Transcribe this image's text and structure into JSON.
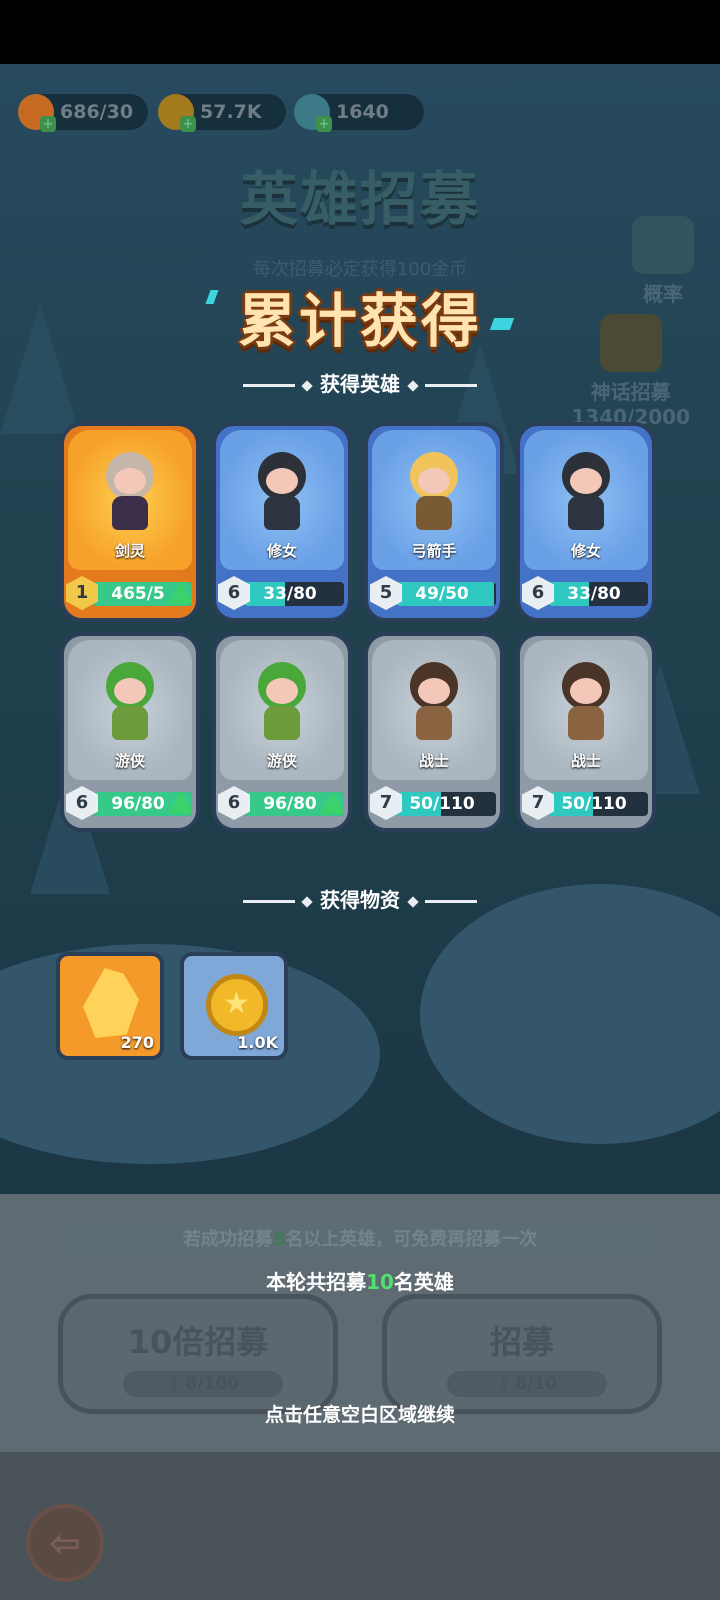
{
  "resources": [
    {
      "icon": "energy-icon",
      "value": "686/30"
    },
    {
      "icon": "gold-coin-icon",
      "value": "57.7K"
    },
    {
      "icon": "crystal-flower-icon",
      "value": "1640"
    }
  ],
  "header": {
    "title": "英雄招募",
    "subtitle": "每次招募必定获得100金币"
  },
  "side_buttons": {
    "probability": "概率",
    "mythic_label": "神话招募",
    "mythic_progress": "1340/2000"
  },
  "result": {
    "title": "累计获得",
    "heroes_section": "获得英雄",
    "items_section": "获得物资"
  },
  "heroes": [
    {
      "name": "剑灵",
      "level": "1",
      "progress": "465/5",
      "fill": 1.0,
      "upgrade": true,
      "rarity": "orange"
    },
    {
      "name": "修女",
      "level": "6",
      "progress": "33/80",
      "fill": 0.41,
      "upgrade": false,
      "rarity": "blue"
    },
    {
      "name": "弓箭手",
      "level": "5",
      "progress": "49/50",
      "fill": 0.98,
      "upgrade": false,
      "rarity": "blue"
    },
    {
      "name": "修女",
      "level": "6",
      "progress": "33/80",
      "fill": 0.41,
      "upgrade": false,
      "rarity": "blue"
    },
    {
      "name": "游侠",
      "level": "6",
      "progress": "96/80",
      "fill": 1.0,
      "upgrade": true,
      "rarity": "gray"
    },
    {
      "name": "游侠",
      "level": "6",
      "progress": "96/80",
      "fill": 1.0,
      "upgrade": true,
      "rarity": "gray"
    },
    {
      "name": "战士",
      "level": "7",
      "progress": "50/110",
      "fill": 0.45,
      "upgrade": false,
      "rarity": "gray"
    },
    {
      "name": "战士",
      "level": "7",
      "progress": "50/110",
      "fill": 0.45,
      "upgrade": false,
      "rarity": "gray"
    }
  ],
  "items": [
    {
      "icon": "crystal-icon",
      "count": "270"
    },
    {
      "icon": "gold-coin-icon",
      "count": "1.0K"
    }
  ],
  "bottom": {
    "bonus_a": "若成功招募",
    "bonus_num": "5",
    "bonus_b": "名以上英雄，可免费再招募一次",
    "summary_a": "本轮共招募",
    "summary_num": "10",
    "summary_b": "名英雄",
    "ten_label": "10倍招募",
    "ten_cost": "8/100",
    "single_label": "招募",
    "single_cost": "8/10",
    "continue": "点击任意空白区域继续"
  },
  "colors": {
    "accent_green": "#52e070",
    "title_text": "#ffe3b0",
    "progress_teal": "#2fc8c0"
  }
}
